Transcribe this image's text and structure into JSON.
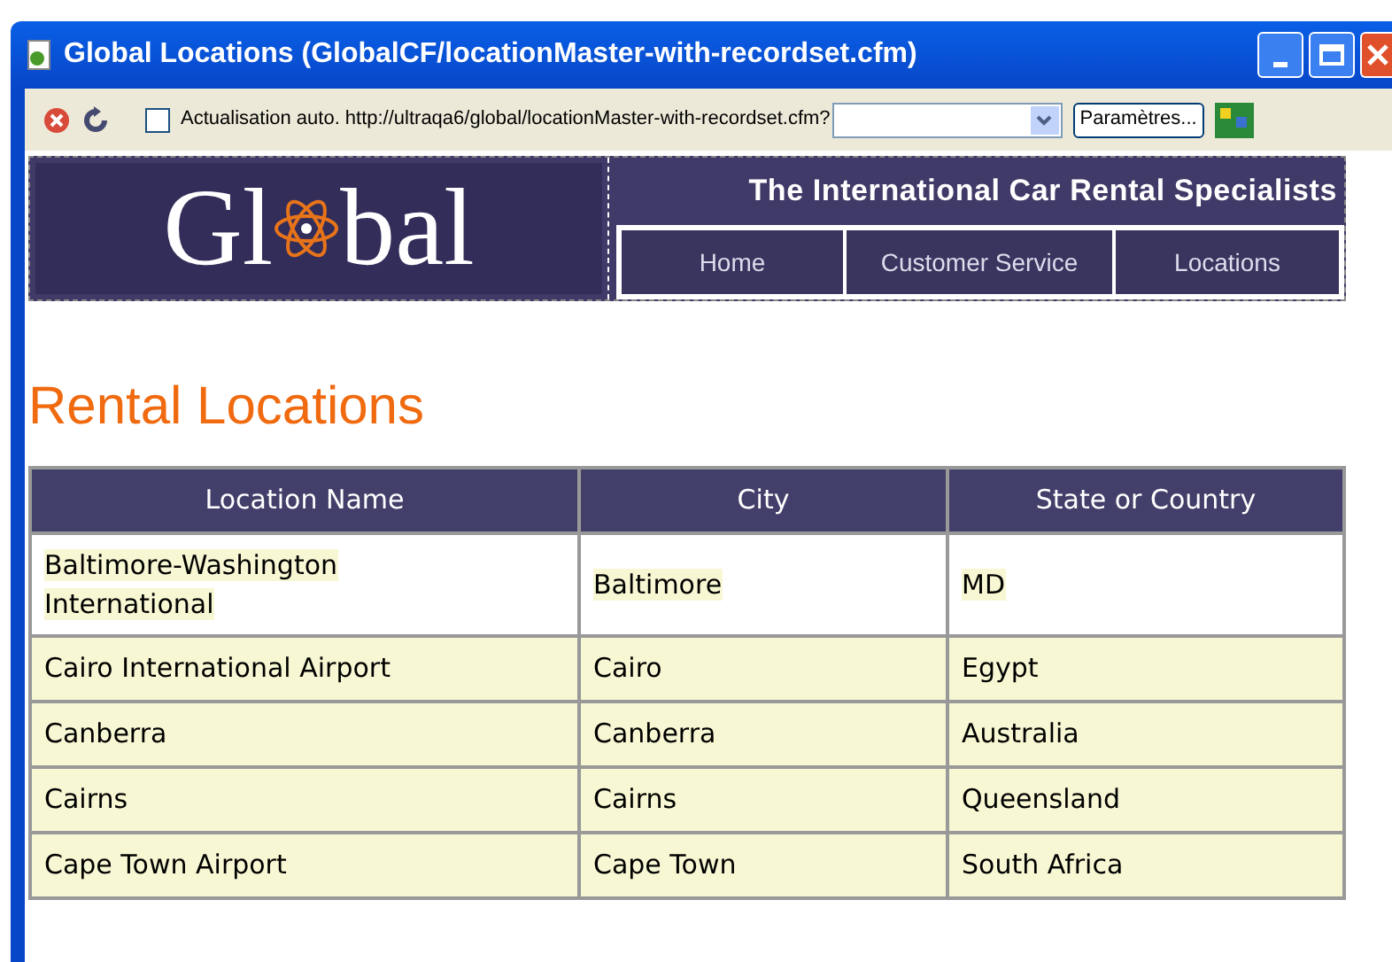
{
  "window": {
    "title": "Global Locations (GlobalCF/locationMaster-with-recordset.cfm)"
  },
  "toolbar": {
    "auto_refresh": {
      "label": "Actualisation auto.",
      "checked": false
    },
    "url": "http://ultraqa6/global/locationMaster-with-recordset.cfm?",
    "settings_button": "Paramètres..."
  },
  "header": {
    "logo": {
      "left": "Gl",
      "right": "bal"
    },
    "tagline": "The International Car Rental Specialists",
    "nav": [
      "Home",
      "Customer Service",
      "Locations"
    ]
  },
  "heading": "Rental Locations",
  "table": {
    "columns": [
      "Location Name",
      "City",
      "State or Country"
    ],
    "rows": [
      {
        "cells": [
          "Baltimore-Washington International",
          "Baltimore",
          "MD"
        ],
        "selected": true
      },
      {
        "cells": [
          "Cairo International Airport",
          "Cairo",
          "Egypt"
        ],
        "selected": false
      },
      {
        "cells": [
          "Canberra",
          "Canberra",
          "Australia"
        ],
        "selected": false
      },
      {
        "cells": [
          "Cairns",
          "Cairns",
          "Queensland"
        ],
        "selected": false
      },
      {
        "cells": [
          "Cape Town Airport",
          "Cape Town",
          "South Africa"
        ],
        "selected": false
      }
    ]
  }
}
